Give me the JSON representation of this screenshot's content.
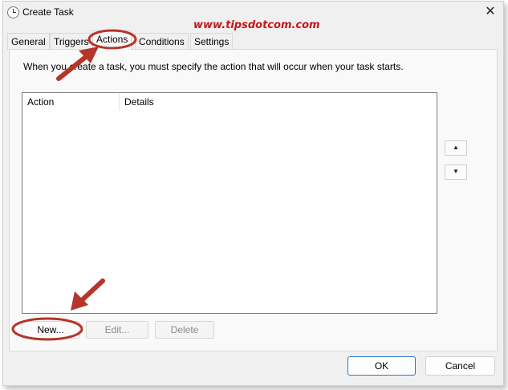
{
  "window": {
    "title": "Create Task",
    "close_glyph": "✕"
  },
  "watermark": "www.tipsdotcom.com",
  "tabs": [
    {
      "label": "General",
      "active": false
    },
    {
      "label": "Triggers",
      "active": false
    },
    {
      "label": "Actions",
      "active": true
    },
    {
      "label": "Conditions",
      "active": false
    },
    {
      "label": "Settings",
      "active": false
    }
  ],
  "actions_tab": {
    "instruction": "When you create a task, you must specify the action that will occur when your task starts.",
    "columns": [
      "Action",
      "Details"
    ],
    "rows": [],
    "move_up_glyph": "▲",
    "move_down_glyph": "▼",
    "new_label": "New...",
    "edit_label": "Edit...",
    "delete_label": "Delete"
  },
  "footer": {
    "ok_label": "OK",
    "cancel_label": "Cancel"
  },
  "annotation_color": "#b5352a",
  "icons": [
    "clock-icon",
    "close-icon",
    "move-up-icon",
    "move-down-icon",
    "annotation-arrow-icon"
  ]
}
